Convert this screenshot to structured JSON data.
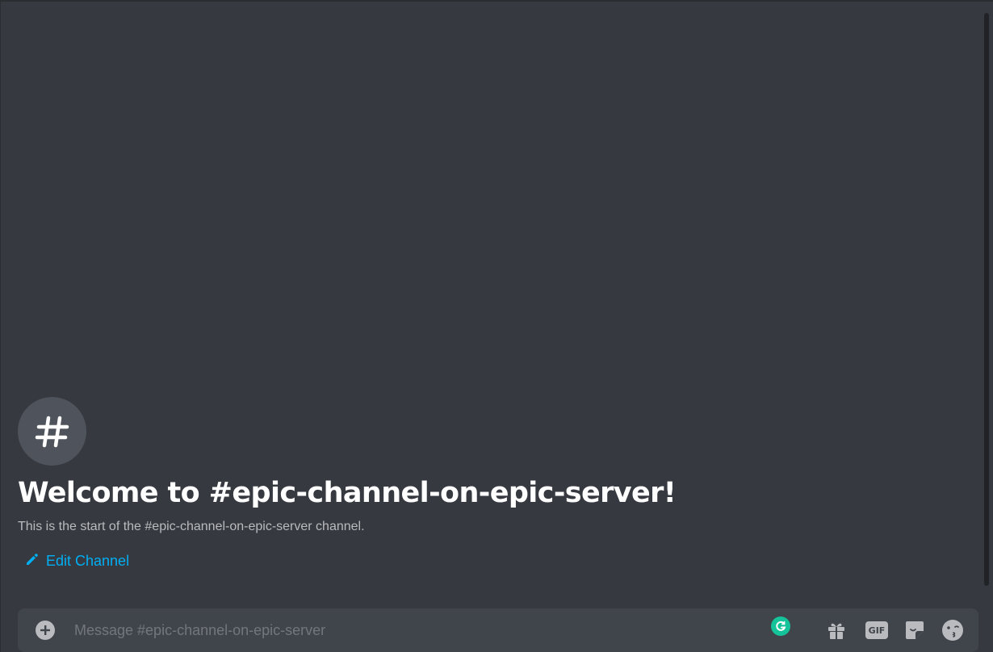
{
  "welcome": {
    "title": "Welcome to #epic-channel-on-epic-server!",
    "subtitle": "This is the start of the #epic-channel-on-epic-server channel.",
    "edit_label": "Edit Channel",
    "avatar_icon": "hash-icon"
  },
  "composer": {
    "placeholder": "Message #epic-channel-on-epic-server",
    "value": "",
    "gif_label": "GIF",
    "icons": [
      "plus-circle-icon",
      "grammarly-icon",
      "gift-icon",
      "gif-icon",
      "sticker-icon",
      "emoji-icon"
    ]
  },
  "colors": {
    "background": "#36393f",
    "composer": "#40444b",
    "link": "#00aff4",
    "grammarly": "#15c39a"
  }
}
